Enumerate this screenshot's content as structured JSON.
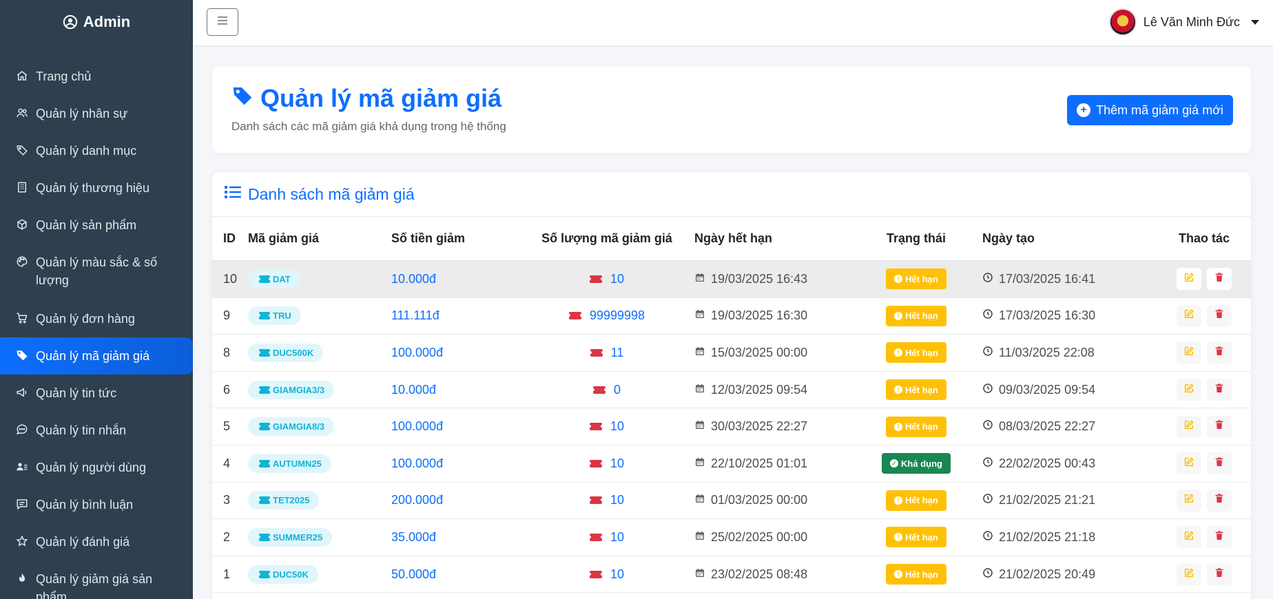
{
  "brand": {
    "title": "Admin",
    "icon": "user-circle-icon"
  },
  "sidebar": {
    "items": [
      {
        "label": "Trang chủ",
        "icon": "home-icon"
      },
      {
        "label": "Quản lý nhân sự",
        "icon": "users-icon"
      },
      {
        "label": "Quản lý danh mục",
        "icon": "tags-icon"
      },
      {
        "label": "Quản lý thương hiệu",
        "icon": "building-icon"
      },
      {
        "label": "Quản lý sản phẩm",
        "icon": "box-icon"
      },
      {
        "label": "Quản lý màu sắc & số lượng",
        "icon": "palette-icon"
      },
      {
        "label": "Quản lý đơn hàng",
        "icon": "cart-icon"
      },
      {
        "label": "Quản lý mã giảm giá",
        "icon": "tag-icon",
        "active": true
      },
      {
        "label": "Quản lý tin tức",
        "icon": "megaphone-icon"
      },
      {
        "label": "Quản lý tin nhắn",
        "icon": "chat-icon"
      },
      {
        "label": "Quản lý người dùng",
        "icon": "user-list-icon"
      },
      {
        "label": "Quản lý bình luận",
        "icon": "comment-icon"
      },
      {
        "label": "Quản lý đánh giá",
        "icon": "star-icon"
      },
      {
        "label": "Quản lý giảm giá sản phẩm",
        "icon": "fire-icon"
      }
    ]
  },
  "topbar": {
    "menu_icon": "hamburger-icon",
    "user_name": "Lê Văn Minh Đức"
  },
  "header": {
    "title": "Quản lý mã giảm giá",
    "subtitle": "Danh sách các mã giảm giá khả dụng trong hệ thống",
    "add_button": "Thêm mã giảm giá mới"
  },
  "list": {
    "title": "Danh sách mã giảm giá",
    "columns": [
      "ID",
      "Mã giảm giá",
      "Số tiền giảm",
      "Số lượng mã giảm giá",
      "Ngày hết hạn",
      "Trạng thái",
      "Ngày tạo",
      "Thao tác"
    ],
    "rows": [
      {
        "id": "10",
        "code": "DAT",
        "amount": "10.000đ",
        "qty": "10",
        "expiry": "19/03/2025 16:43",
        "status": "Hết hạn",
        "created": "17/03/2025 16:41"
      },
      {
        "id": "9",
        "code": "TRU",
        "amount": "111.111đ",
        "qty": "99999998",
        "expiry": "19/03/2025 16:30",
        "status": "Hết hạn",
        "created": "17/03/2025 16:30"
      },
      {
        "id": "8",
        "code": "DUC500K",
        "amount": "100.000đ",
        "qty": "11",
        "expiry": "15/03/2025 00:00",
        "status": "Hết hạn",
        "created": "11/03/2025 22:08"
      },
      {
        "id": "6",
        "code": "GIAMGIA3/3",
        "amount": "10.000đ",
        "qty": "0",
        "expiry": "12/03/2025 09:54",
        "status": "Hết hạn",
        "created": "09/03/2025 09:54"
      },
      {
        "id": "5",
        "code": "GIAMGIA8/3",
        "amount": "100.000đ",
        "qty": "10",
        "expiry": "30/03/2025 22:27",
        "status": "Hết hạn",
        "created": "08/03/2025 22:27"
      },
      {
        "id": "4",
        "code": "AUTUMN25",
        "amount": "100.000đ",
        "qty": "10",
        "expiry": "22/10/2025 01:01",
        "status": "Khả dụng",
        "created": "22/02/2025 00:43"
      },
      {
        "id": "3",
        "code": "TET2025",
        "amount": "200.000đ",
        "qty": "10",
        "expiry": "01/03/2025 00:00",
        "status": "Hết hạn",
        "created": "21/02/2025 21:21"
      },
      {
        "id": "2",
        "code": "SUMMER25",
        "amount": "35.000đ",
        "qty": "10",
        "expiry": "25/02/2025 00:00",
        "status": "Hết hạn",
        "created": "21/02/2025 21:18"
      },
      {
        "id": "1",
        "code": "DUC50K",
        "amount": "50.000đ",
        "qty": "10",
        "expiry": "23/02/2025 08:48",
        "status": "Hết hạn",
        "created": "21/02/2025 20:49"
      }
    ]
  },
  "colors": {
    "primary": "#0d6efd",
    "sidebar": "#2e3f4f",
    "expired": "#ffc107",
    "active": "#198754",
    "danger": "#dc3545",
    "code": "#0fb5d8"
  }
}
